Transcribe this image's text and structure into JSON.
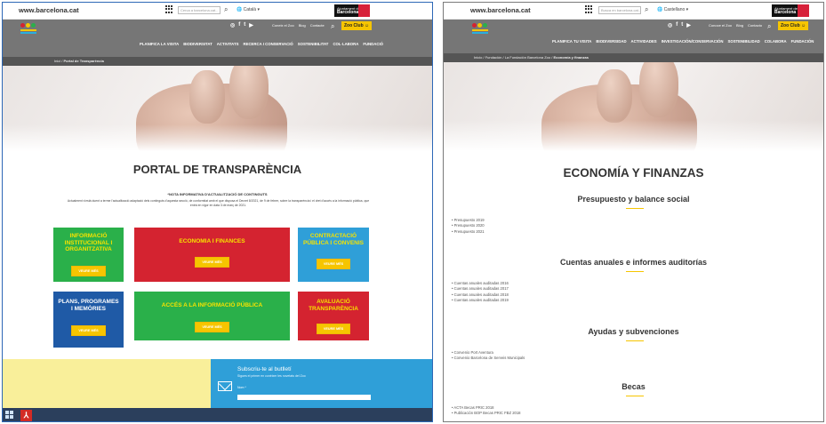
{
  "left": {
    "site": "www.barcelona.cat",
    "search_placeholder": "Cerca a barcelona.cat...",
    "language": "Català",
    "ajuntament_line1": "Ajuntament de",
    "ajuntament_line2": "Barcelona",
    "socials": [
      "f",
      "t",
      "▶"
    ],
    "sublinks": [
      "Coneix el Zoo",
      "Blog",
      "Contacte"
    ],
    "zoo_club": "Zoo Club",
    "menu": [
      "PLANIFICA LA VISITA",
      "BIODIVERSITAT",
      "ACTIVITATS",
      "RECERCA I CONSERVACIÓ",
      "SOSTENIBILITAT",
      "COL·LABORA",
      "FUNDACIÓ"
    ],
    "breadcrumb": [
      "Inici",
      "Portal de Transparència"
    ],
    "page_title": "PORTAL DE TRANSPARÈNCIA",
    "nota_title": "*NOTA INFORMATIVA D'ACTUALITZACIÓ DE CONTINGUTS",
    "nota_text": "Actualment s'està duent a terme l'actualització adaptació dels continguts d'aquesta secció, de conformitat amb el que disposa el Decret 8/2021, de 9 de febrer, sobre la transparència i el dret d'accés a la informació pública, que entrà en vigor en data 3 de març de 2021.",
    "tiles": [
      {
        "title": "INFORMACIÓ INSTITUCIONAL I ORGANITZATIVA",
        "button": "VEURE MÉS",
        "color": "#2ab04a"
      },
      {
        "title": "ECONOMIA I FINANCES",
        "button": "VEURE MÉS",
        "color": "#d42330"
      },
      {
        "title": "CONTRACTACIÓ PÚBLICA I CONVENIS",
        "button": "VEURE MÉS",
        "color": "#2f9fd8"
      },
      {
        "title": "PLANS, PROGRAMES I MEMÒRIES",
        "button": "VEURE MÉS",
        "color": "#1f5aa6"
      },
      {
        "title": "ACCÉS A LA INFORMACIÓ PÚBLICA",
        "button": "VEURE MÉS",
        "color": "#2ab04a"
      },
      {
        "title": "AVALUACIÓ TRANSPARÈNCIA",
        "button": "VEURE MÉS",
        "color": "#d42330"
      }
    ],
    "newsletter_title": "Subscriu-te al butlletí",
    "newsletter_sub": "Sigues el primer en conèixer les novetats del Zoo",
    "newsletter_label": "Nom *"
  },
  "right": {
    "site": "www.barcelona.cat",
    "search_placeholder": "Busca en barcelona.cat...",
    "language": "Castellano",
    "ajuntament_line1": "Ajuntament de",
    "ajuntament_line2": "Barcelona",
    "socials": [
      "f",
      "t",
      "▶"
    ],
    "sublinks": [
      "Conoce el Zoo",
      "Blog",
      "Contacto"
    ],
    "zoo_club": "Zoo Club",
    "menu": [
      "PLANIFICA TU VISITA",
      "BIODIVERSIDAD",
      "ACTIVIDADES",
      "INVESTIGACIÓN/CONSERVACIÓN",
      "SOSTENIBILIDAD",
      "COLABORA",
      "FUNDACIÓN"
    ],
    "breadcrumb": [
      "Inicio",
      "Fundación",
      "La Fundación Barcelona Zoo",
      "Economía y finanzas"
    ],
    "page_title": "ECONOMÍA Y FINANZAS",
    "sections": [
      {
        "title": "Presupuesto y balance social",
        "items": [
          "Presupuesto 2019",
          "Presupuesto 2020",
          "Presupuesto 2021"
        ]
      },
      {
        "title": "Cuentas anuales e informes auditorías",
        "items": [
          "Cuentas anuales auditadas 2016",
          "Cuentas anuales auditadas 2017",
          "Cuentas anuales auditadas 2018",
          "Cuentas anuales auditadas 2019"
        ]
      },
      {
        "title": "Ayudas y subvenciones",
        "items": [
          "Convenio Port Aventura",
          "Convenio Barcelona de Serveis Municipals"
        ]
      },
      {
        "title": "Becas",
        "items": [
          "ACTA Becas PRIC 2018",
          "Publicación BOP Becas PRIC FBZ 2018"
        ]
      }
    ]
  }
}
